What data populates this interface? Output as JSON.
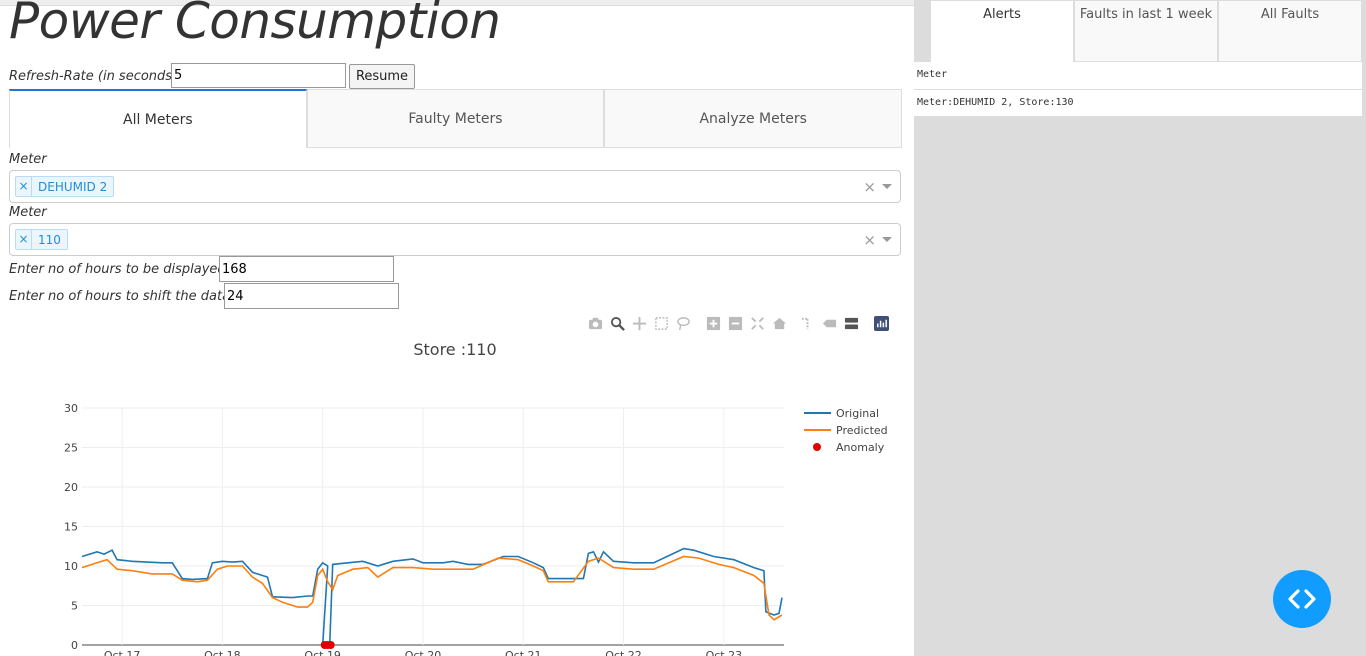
{
  "header": {
    "title": "Power Consumption"
  },
  "refresh": {
    "label": "Refresh-Rate (in seconds)",
    "value": "5",
    "button": "Resume"
  },
  "tabs": [
    {
      "label": "All Meters",
      "active": true
    },
    {
      "label": "Faulty Meters",
      "active": false
    },
    {
      "label": "Analyze Meters",
      "active": false
    }
  ],
  "meter_select": {
    "label": "Meter",
    "chip": "DEHUMID 2",
    "chip_remove": "×",
    "clear": "×"
  },
  "store_select": {
    "label": "Meter",
    "chip": "110",
    "chip_remove": "×",
    "clear": "×"
  },
  "hours_display": {
    "label": "Enter no of hours to be displayed",
    "value": "168"
  },
  "hours_shift": {
    "label": "Enter no of hours to shift the data",
    "value": "24"
  },
  "modebar_icons": [
    "camera-icon",
    "zoom-icon",
    "pan-icon",
    "box-select-icon",
    "lasso-icon",
    "zoom-in-icon",
    "zoom-out-icon",
    "autoscale-icon",
    "reset-axes-icon",
    "spike-lines-icon",
    "hover-closest-icon",
    "hover-compare-icon",
    "plotly-logo-icon"
  ],
  "chart_data": {
    "type": "line",
    "title": "Store :110",
    "ylim": [
      0,
      30
    ],
    "yticks": [
      0,
      5,
      10,
      15,
      20,
      25,
      30
    ],
    "x_tick_labels": [
      "Oct 17",
      "Oct 18",
      "Oct 19",
      "Oct 20",
      "Oct 21",
      "Oct 22",
      "Oct 23"
    ],
    "x_range_days": [
      16.6,
      23.6
    ],
    "grid": true,
    "legend_position": "top-right",
    "series": [
      {
        "name": "Original",
        "color": "#1f77b4",
        "points": [
          [
            16.6,
            11.2
          ],
          [
            16.75,
            11.8
          ],
          [
            16.82,
            11.5
          ],
          [
            16.9,
            12.0
          ],
          [
            16.95,
            10.8
          ],
          [
            17.1,
            10.6
          ],
          [
            17.4,
            10.4
          ],
          [
            17.5,
            10.4
          ],
          [
            17.6,
            8.4
          ],
          [
            17.7,
            8.3
          ],
          [
            17.85,
            8.4
          ],
          [
            17.9,
            10.4
          ],
          [
            18.0,
            10.6
          ],
          [
            18.1,
            10.5
          ],
          [
            18.2,
            10.6
          ],
          [
            18.3,
            9.2
          ],
          [
            18.4,
            8.8
          ],
          [
            18.45,
            8.6
          ],
          [
            18.5,
            6.1
          ],
          [
            18.7,
            6.0
          ],
          [
            18.85,
            6.2
          ],
          [
            18.9,
            6.2
          ],
          [
            18.95,
            9.6
          ],
          [
            19.0,
            10.4
          ],
          [
            19.05,
            10.0
          ],
          [
            19.0,
            0.0
          ],
          [
            19.07,
            0.0
          ],
          [
            19.1,
            10.2
          ],
          [
            19.25,
            10.4
          ],
          [
            19.4,
            10.6
          ],
          [
            19.55,
            10.0
          ],
          [
            19.7,
            10.6
          ],
          [
            19.9,
            10.9
          ],
          [
            20.0,
            10.4
          ],
          [
            20.2,
            10.4
          ],
          [
            20.3,
            10.6
          ],
          [
            20.45,
            10.2
          ],
          [
            20.6,
            10.2
          ],
          [
            20.8,
            11.2
          ],
          [
            20.95,
            11.2
          ],
          [
            21.1,
            10.4
          ],
          [
            21.2,
            9.8
          ],
          [
            21.25,
            8.4
          ],
          [
            21.5,
            8.4
          ],
          [
            21.6,
            8.4
          ],
          [
            21.65,
            11.6
          ],
          [
            21.7,
            11.8
          ],
          [
            21.75,
            10.5
          ],
          [
            21.8,
            11.8
          ],
          [
            21.9,
            10.6
          ],
          [
            22.1,
            10.4
          ],
          [
            22.3,
            10.4
          ],
          [
            22.6,
            12.2
          ],
          [
            22.7,
            12.0
          ],
          [
            22.9,
            11.2
          ],
          [
            23.1,
            10.8
          ],
          [
            23.3,
            9.8
          ],
          [
            23.4,
            9.4
          ],
          [
            23.42,
            4.2
          ],
          [
            23.5,
            3.8
          ],
          [
            23.55,
            4.0
          ],
          [
            23.58,
            6.0
          ]
        ]
      },
      {
        "name": "Predicted",
        "color": "#ff7f0e",
        "points": [
          [
            16.6,
            9.8
          ],
          [
            16.75,
            10.4
          ],
          [
            16.85,
            10.8
          ],
          [
            16.9,
            10.2
          ],
          [
            16.95,
            9.6
          ],
          [
            17.1,
            9.4
          ],
          [
            17.3,
            9.0
          ],
          [
            17.5,
            9.0
          ],
          [
            17.6,
            8.2
          ],
          [
            17.75,
            8.0
          ],
          [
            17.85,
            8.2
          ],
          [
            17.95,
            9.6
          ],
          [
            18.05,
            10.0
          ],
          [
            18.2,
            10.0
          ],
          [
            18.3,
            8.6
          ],
          [
            18.4,
            7.8
          ],
          [
            18.5,
            6.0
          ],
          [
            18.6,
            5.4
          ],
          [
            18.75,
            4.8
          ],
          [
            18.85,
            4.8
          ],
          [
            18.9,
            5.4
          ],
          [
            18.95,
            8.8
          ],
          [
            19.0,
            9.6
          ],
          [
            19.05,
            8.0
          ],
          [
            19.1,
            7.0
          ],
          [
            19.15,
            8.8
          ],
          [
            19.3,
            9.6
          ],
          [
            19.45,
            9.8
          ],
          [
            19.55,
            8.6
          ],
          [
            19.7,
            9.8
          ],
          [
            19.9,
            9.8
          ],
          [
            20.1,
            9.6
          ],
          [
            20.3,
            9.6
          ],
          [
            20.5,
            9.6
          ],
          [
            20.75,
            11.0
          ],
          [
            20.95,
            10.8
          ],
          [
            21.1,
            10.0
          ],
          [
            21.2,
            9.4
          ],
          [
            21.25,
            8.0
          ],
          [
            21.5,
            8.0
          ],
          [
            21.65,
            10.6
          ],
          [
            21.75,
            11.0
          ],
          [
            21.9,
            9.8
          ],
          [
            22.1,
            9.6
          ],
          [
            22.3,
            9.6
          ],
          [
            22.6,
            11.2
          ],
          [
            22.75,
            11.0
          ],
          [
            22.95,
            10.2
          ],
          [
            23.1,
            9.8
          ],
          [
            23.3,
            8.8
          ],
          [
            23.4,
            7.8
          ],
          [
            23.45,
            3.8
          ],
          [
            23.5,
            3.2
          ],
          [
            23.58,
            3.8
          ]
        ]
      },
      {
        "name": "Anomaly",
        "color": "#e00000",
        "mode": "markers",
        "points": [
          [
            19.02,
            0.0
          ],
          [
            19.05,
            0.0
          ],
          [
            19.08,
            0.0
          ]
        ]
      }
    ]
  },
  "right": {
    "tabs": [
      {
        "label": "Alerts",
        "active": true
      },
      {
        "label": "Faults in last 1 week",
        "active": false
      },
      {
        "label": "All Faults",
        "active": false
      }
    ],
    "table_header": "Meter",
    "rows": [
      "Meter:DEHUMID 2, Store:130"
    ]
  }
}
